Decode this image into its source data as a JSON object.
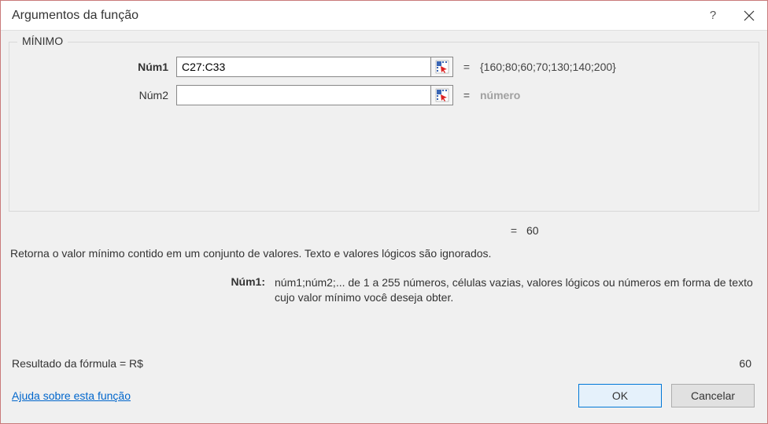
{
  "titlebar": {
    "title": "Argumentos da função"
  },
  "function": {
    "name": "MÍNIMO"
  },
  "args": [
    {
      "label": "Núm1",
      "bold": true,
      "value": "C27:C33",
      "preview": "{160;80;60;70;130;140;200}",
      "placeholder": false
    },
    {
      "label": "Núm2",
      "bold": false,
      "value": "",
      "preview": "número",
      "placeholder": true
    }
  ],
  "result_inline": {
    "eq": "=",
    "value": "60"
  },
  "description": "Retorna o valor mínimo contido em um conjunto de valores. Texto e valores lógicos são ignorados.",
  "param": {
    "name": "Núm1:",
    "text": "núm1;núm2;... de 1 a 255 números, células vazias, valores lógicos ou números em forma de texto cujo valor mínimo você deseja obter."
  },
  "formula_result": {
    "label": "Resultado da fórmula =    R$",
    "value": "60"
  },
  "help_link": "Ajuda sobre esta função",
  "buttons": {
    "ok": "OK",
    "cancel": "Cancelar"
  }
}
